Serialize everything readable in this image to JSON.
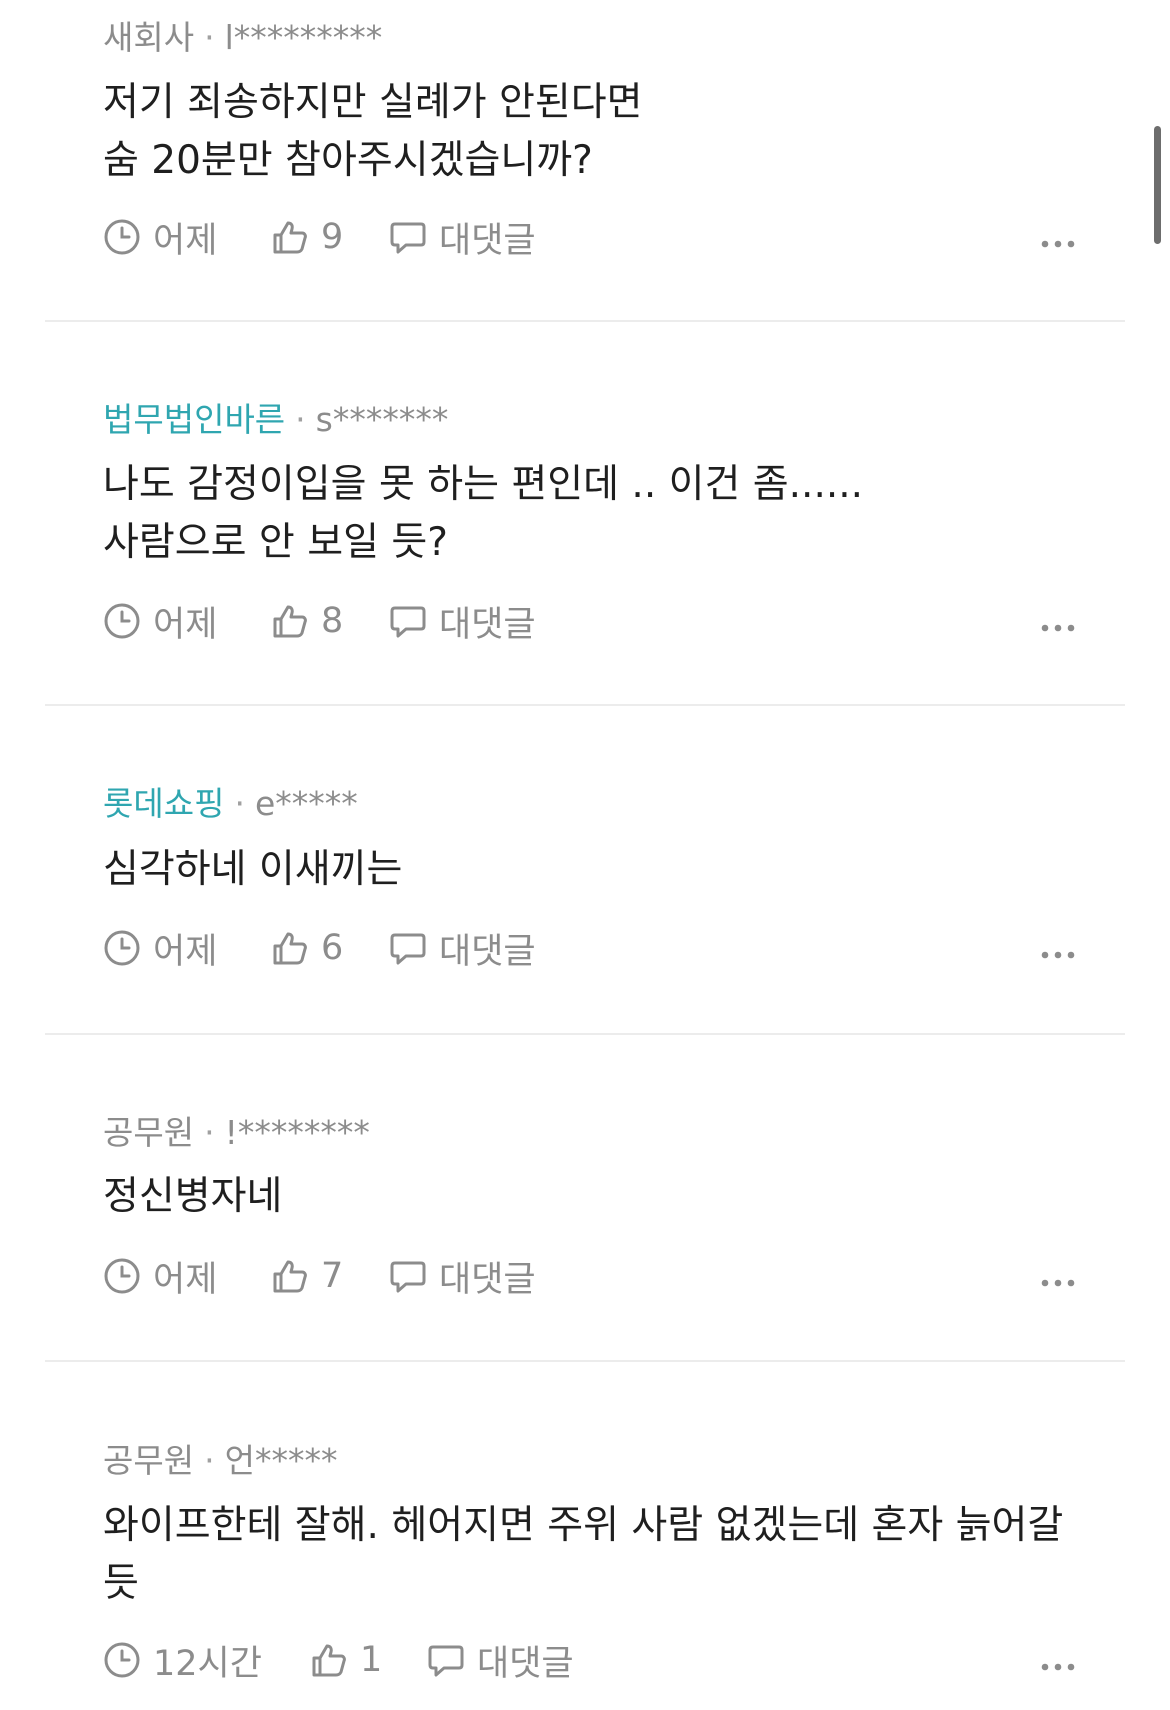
{
  "comments": [
    {
      "company": "새회사",
      "user": "l*********",
      "text": "저기 죄송하지만 실례가 안된다면\n숨 20분만 참아주시겠습니까?",
      "time": "어제",
      "likes": "9",
      "reply_label": "대댓글"
    },
    {
      "company": "법무법인바른",
      "user": "s*******",
      "text": "나도 감정이입을 못 하는 편인데 .. 이건 좀......\n사람으로 안 보일 듯?",
      "time": "어제",
      "likes": "8",
      "reply_label": "대댓글"
    },
    {
      "company": "롯데쇼핑",
      "user": "e*****",
      "text": "심각하네 이새끼는",
      "time": "어제",
      "likes": "6",
      "reply_label": "대댓글"
    },
    {
      "company": "공무원",
      "user": "!********",
      "text": "정신병자네",
      "time": "어제",
      "likes": "7",
      "reply_label": "대댓글"
    },
    {
      "company": "공무원",
      "user": "언*****",
      "text": "와이프한테 잘해. 헤어지면 주위 사람 없겠는데 혼자 늙어갈\n듯",
      "time": "12시간",
      "likes": "1",
      "reply_label": "대댓글"
    }
  ],
  "meta_separator": "·",
  "colors": {
    "company_badge": "#2fa6b0",
    "meta_gray": "#8c8c8c",
    "body_text": "#1f1f1f",
    "divider": "#ececec"
  },
  "icons": {
    "time": "clock-icon",
    "like": "thumbs-up-icon",
    "reply": "speech-bubble-icon",
    "more": "more-dots-icon"
  }
}
